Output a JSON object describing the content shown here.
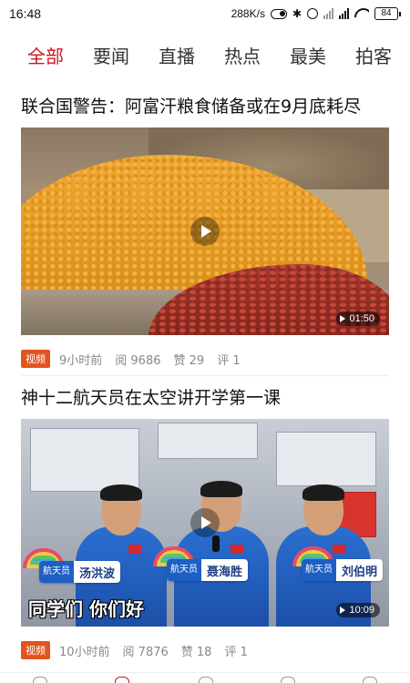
{
  "status_bar": {
    "time": "16:48",
    "network_speed": "288K/s",
    "battery": "84",
    "icons": [
      "toggle-icon",
      "bluetooth-icon",
      "alarm-icon",
      "signal-icon",
      "signal-icon",
      "wifi-icon",
      "battery-icon"
    ]
  },
  "tabs": [
    {
      "label": "全部",
      "active": true
    },
    {
      "label": "要闻",
      "active": false
    },
    {
      "label": "直播",
      "active": false
    },
    {
      "label": "热点",
      "active": false
    },
    {
      "label": "最美",
      "active": false
    },
    {
      "label": "拍客",
      "active": false
    }
  ],
  "articles": [
    {
      "headline": "联合国警告：阿富汗粮食储备或在9月底耗尽",
      "badge": "视频",
      "time": "9小时前",
      "views": "阅 9686",
      "likes": "赞 29",
      "comments": "评 1",
      "duration": "01:50"
    },
    {
      "headline": "神十二航天员在太空讲开学第一课",
      "badge": "视频",
      "time": "10小时前",
      "views": "阅 7876",
      "likes": "赞 18",
      "comments": "评 1",
      "duration": "10:09",
      "subtitle": "同学们 你们好",
      "nameplates": [
        {
          "role": "航天员",
          "name": "汤洪波"
        },
        {
          "role": "航天员",
          "name": "聂海胜"
        },
        {
          "role": "航天员",
          "name": "刘伯明"
        }
      ]
    }
  ],
  "colors": {
    "accent": "#c8161d",
    "badge": "#e2541f",
    "meta_text": "#888888"
  }
}
